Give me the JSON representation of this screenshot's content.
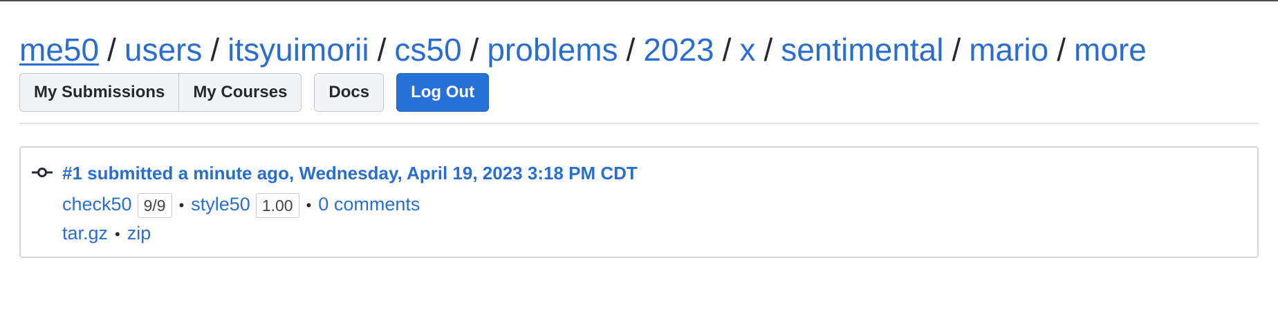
{
  "breadcrumb": {
    "items": [
      "me50",
      "users",
      "itsyuimorii",
      "cs50",
      "problems",
      "2023",
      "x",
      "sentimental",
      "mario",
      "more"
    ],
    "separator": "/"
  },
  "nav": {
    "my_submissions": "My Submissions",
    "my_courses": "My Courses",
    "docs": "Docs",
    "log_out": "Log Out"
  },
  "submission": {
    "title": "#1 submitted a minute ago, Wednesday, April 19, 2023 3:18 PM CDT",
    "check50_label": "check50",
    "check50_score": "9/9",
    "style50_label": "style50",
    "style50_score": "1.00",
    "comments": "0 comments",
    "tar_gz": "tar.gz",
    "zip": "zip",
    "bullet": "•"
  },
  "colors": {
    "link": "#2a6dd1",
    "primary_button": "#2770d6"
  },
  "icons": {
    "commit": "commit-icon"
  }
}
